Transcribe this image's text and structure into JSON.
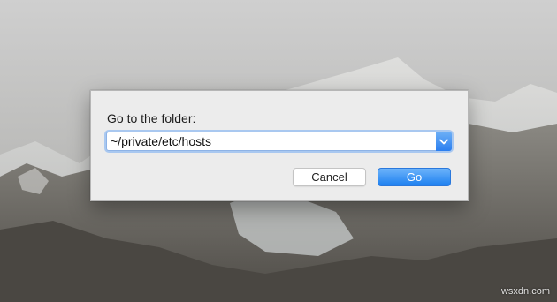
{
  "dialog": {
    "prompt": "Go to the folder:",
    "path_value": "~/private/etc/hosts",
    "cancel_label": "Cancel",
    "go_label": "Go"
  },
  "icons": {
    "dropdown": "chevron-down-icon"
  },
  "colors": {
    "accent": "#2a7ef0",
    "dialog_bg": "#ececec"
  },
  "watermark": "wsxdn.com"
}
